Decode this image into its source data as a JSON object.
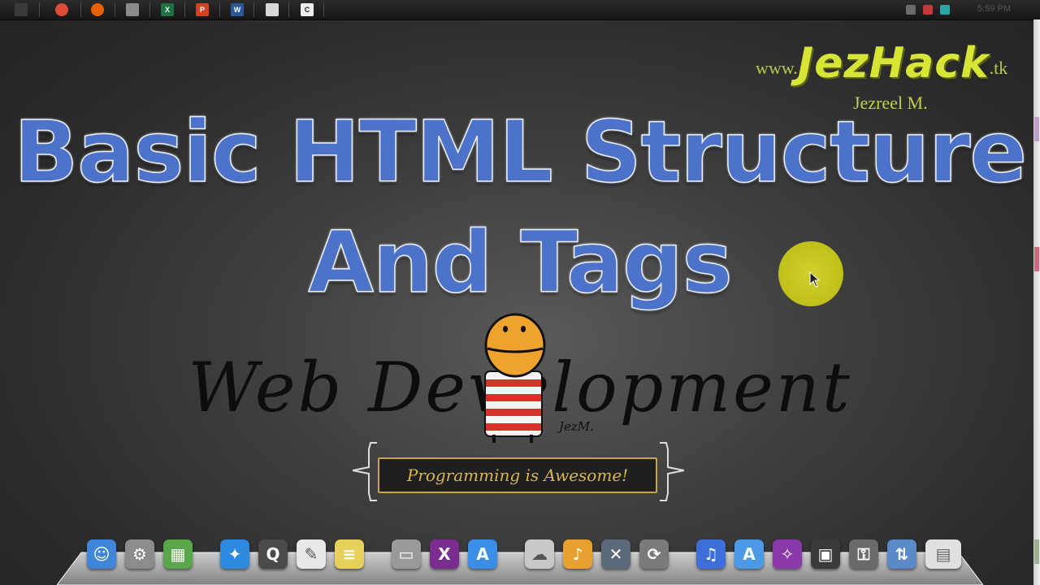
{
  "taskbar": {
    "apps": [
      {
        "name": "apple-icon",
        "glyph": "",
        "color": "#3a3a3a"
      },
      {
        "name": "chrome-icon",
        "glyph": "",
        "color": "#dd4b39"
      },
      {
        "name": "firefox-icon",
        "glyph": "",
        "color": "#e66000"
      },
      {
        "name": "calculator-icon",
        "glyph": "",
        "color": "#8a8a8a"
      },
      {
        "name": "excel-icon",
        "glyph": "X",
        "color": "#1e7145"
      },
      {
        "name": "powerpoint-icon",
        "glyph": "P",
        "color": "#d04423"
      },
      {
        "name": "word-icon",
        "glyph": "W",
        "color": "#2b579a"
      },
      {
        "name": "notepad-icon",
        "glyph": "",
        "color": "#d8d8d8"
      },
      {
        "name": "camtasia-icon",
        "glyph": "C",
        "color": "#eeeeee"
      }
    ],
    "clock": "5:59 PM"
  },
  "watermark": {
    "prefix": "www.",
    "brand": "JezHack",
    "suffix": ".tk",
    "author": "Jezreel M."
  },
  "slide": {
    "title_line1": "Basic HTML Structure",
    "title_line2": "And Tags",
    "logo_text": "Web Development",
    "logo_signature": "JezM.",
    "tagline": "Programming is Awesome!"
  },
  "colors": {
    "title": "#4c72c9",
    "watermark": "#d7e536",
    "cursor_highlight": "#dede2a",
    "tagline": "#d9b650"
  },
  "dock": {
    "items": [
      {
        "name": "finder-icon",
        "glyph": "☺",
        "color": "#3f86d8"
      },
      {
        "name": "system-preferences-icon",
        "glyph": "⚙",
        "color": "#8c8c8c"
      },
      {
        "name": "dashboard-icon",
        "glyph": "▦",
        "color": "#5aa64a"
      },
      {
        "name": "safari-icon",
        "glyph": "✦",
        "color": "#2c8ae0"
      },
      {
        "name": "quicktime-icon",
        "glyph": "Q",
        "color": "#4a4a4a"
      },
      {
        "name": "textedit-icon",
        "glyph": "✎",
        "color": "#e8e8e8"
      },
      {
        "name": "stickies-icon",
        "glyph": "≡",
        "color": "#e8d15a"
      },
      {
        "name": "drive-icon",
        "glyph": "▭",
        "color": "#9a9a9a"
      },
      {
        "name": "xcode-icon",
        "glyph": "X",
        "color": "#7a2d8f"
      },
      {
        "name": "app-store-icon",
        "glyph": "A",
        "color": "#3b8ee6"
      },
      {
        "name": "icloud-icon",
        "glyph": "☁",
        "color": "#c8c8c8"
      },
      {
        "name": "garageband-icon",
        "glyph": "♪",
        "color": "#e8a030"
      },
      {
        "name": "utilities-icon",
        "glyph": "✕",
        "color": "#5a6a7a"
      },
      {
        "name": "sync-icon",
        "glyph": "⟳",
        "color": "#7a7a7a"
      },
      {
        "name": "itunes-icon",
        "glyph": "♫",
        "color": "#3e6fd8"
      },
      {
        "name": "applications-icon",
        "glyph": "A",
        "color": "#4a9ae8"
      },
      {
        "name": "photo-booth-icon",
        "glyph": "✧",
        "color": "#8a3aa8"
      },
      {
        "name": "mission-control-icon",
        "glyph": "▣",
        "color": "#3a3a3a"
      },
      {
        "name": "keychain-icon",
        "glyph": "⚿",
        "color": "#6a6a6a"
      },
      {
        "name": "network-icon",
        "glyph": "⇅",
        "color": "#5a8ac8"
      },
      {
        "name": "trash-icon",
        "glyph": "▤",
        "color": "#e0e0e0"
      }
    ]
  }
}
